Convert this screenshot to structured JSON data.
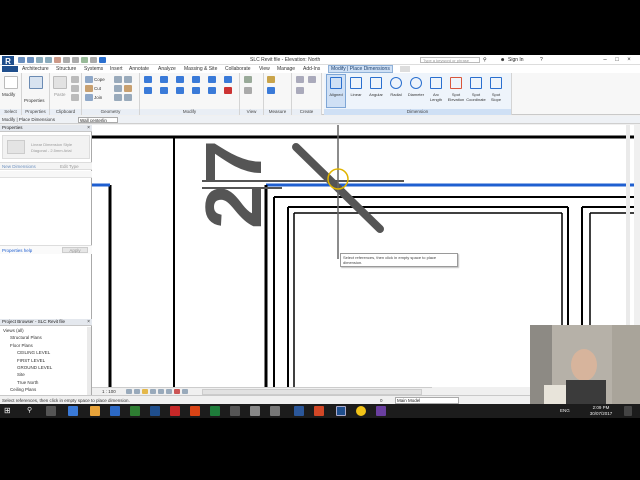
{
  "window": {
    "title": "SLC Revit file - Elevation: North",
    "search_placeholder": "Type a keyword or phrase",
    "sign_in": "Sign In",
    "logo": "R"
  },
  "ribbon_tabs": [
    "Architecture",
    "Structure",
    "Systems",
    "Insert",
    "Annotate",
    "Analyze",
    "Massing & Site",
    "Collaborate",
    "View",
    "Manage",
    "Add-Ins",
    "Modify | Place Dimensions"
  ],
  "ribbon": {
    "modify_label": "Modify",
    "properties_label": "Properties",
    "panels": {
      "select": "Select",
      "properties": "Properties",
      "clipboard": "Clipboard",
      "geometry": "Geometry",
      "modify": "Modify",
      "view": "View",
      "measure": "Measure",
      "create": "Create",
      "dimension": "Dimension"
    },
    "clipboard_paste": "Paste",
    "geometry_items": [
      "Cope",
      "Cut",
      "Join"
    ],
    "dimension_tools": [
      "Aligned",
      "Linear",
      "Angular",
      "Radial",
      "Diameter",
      "Arc Length",
      "Spot Elevation",
      "Spot Coordinate",
      "Spot Slope"
    ],
    "dimension_tool_lines": [
      [
        "Aligned"
      ],
      [
        "Linear"
      ],
      [
        "Angular"
      ],
      [
        "Radial"
      ],
      [
        "Diameter"
      ],
      [
        "Arc",
        "Length"
      ],
      [
        "Spot",
        "Elevation"
      ],
      [
        "Spot",
        "Coordinate"
      ],
      [
        "Spot",
        "Slope"
      ]
    ]
  },
  "options_bar": {
    "context": "Modify | Place Dimensions",
    "placement": "Wall centerlin"
  },
  "properties": {
    "title": "Properties",
    "type_name": "Linear Dimension Style",
    "type_sub": "Diagonal - 2.5mm Arial",
    "selector": "New Dimensions",
    "edit_type": "Edit Type",
    "help": "Properties help",
    "apply": "Apply"
  },
  "project_browser": {
    "title": "Project Browser - SLC Revit file",
    "items": [
      {
        "label": "Views (all)",
        "level": 0,
        "bold": false
      },
      {
        "label": "Structural Plans",
        "level": 1,
        "bold": false
      },
      {
        "label": "Floor Plans",
        "level": 1,
        "bold": false
      },
      {
        "label": "CEILING LEVEL",
        "level": 2,
        "bold": false
      },
      {
        "label": "FIRST LEVEL",
        "level": 2,
        "bold": false
      },
      {
        "label": "GROUND LEVEL",
        "level": 2,
        "bold": false
      },
      {
        "label": "Site",
        "level": 2,
        "bold": false
      },
      {
        "label": "True North",
        "level": 2,
        "bold": false
      },
      {
        "label": "Ceiling Plans",
        "level": 1,
        "bold": false
      },
      {
        "label": "3D Views",
        "level": 1,
        "bold": false
      },
      {
        "label": "Elevations (Building Elevation",
        "level": 1,
        "bold": false
      },
      {
        "label": "East",
        "level": 2,
        "bold": false
      },
      {
        "label": "North",
        "level": 2,
        "bold": true
      },
      {
        "label": "South",
        "level": 2,
        "bold": false
      },
      {
        "label": "West",
        "level": 2,
        "bold": false
      }
    ]
  },
  "canvas": {
    "dimension_text": "27",
    "tooltip": "Select references, then click in empty space to place dimension."
  },
  "view_control": {
    "scale": "1 : 100"
  },
  "status": {
    "message": "Select references, then click in empty space to place dimension.",
    "model": "Main Model",
    "zero": "0"
  },
  "taskbar": {
    "time": "2:09 PM",
    "date": "30/07/2017",
    "lang": "ENG"
  },
  "colors": {
    "blue_line": "#1f5fd0",
    "ribbon_ctx": "#cfe0f5",
    "taskbar": "#1c1c1c"
  }
}
